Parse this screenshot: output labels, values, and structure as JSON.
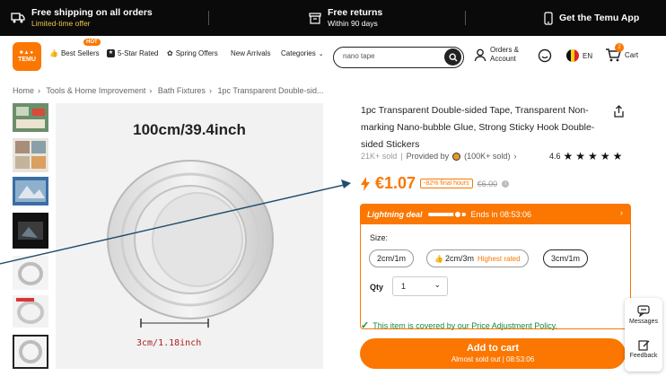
{
  "promo": {
    "shipping_title": "Free shipping on all orders",
    "shipping_sub": "Limited-time offer",
    "returns_title": "Free returns",
    "returns_sub": "Within 90 days",
    "app": "Get the Temu App"
  },
  "header": {
    "logo_line1": "TEMU",
    "nav": {
      "hot_badge": "HOT",
      "best_sellers": "Best Sellers",
      "five_star": "5-Star Rated",
      "spring": "Spring Offers",
      "new_arrivals": "New Arrivals",
      "categories": "Categories"
    },
    "search_value": "nano tape",
    "orders": "Orders &",
    "account": "Account",
    "lang": "EN",
    "cart": "Cart",
    "cart_count": "2"
  },
  "breadcrumb": [
    "Home",
    "Tools & Home Improvement",
    "Bath Fixtures",
    "1pc Transparent Double-sid..."
  ],
  "image": {
    "dimension_top": "100cm/39.4inch",
    "dimension_bottom": "3cm/1.18inch"
  },
  "product": {
    "title": "1pc Transparent Double-sided Tape, Transparent Non-marking Nano-bubble Glue, Strong Sticky Hook Double-sided Stickers",
    "sold": "21K+ sold",
    "provided_by": "Provided by",
    "seller_sold": "(100K+ sold)",
    "rating": "4.6",
    "rating_value": 4.6,
    "price": "€1.07",
    "discount": "-82% final hours",
    "original_price": "€6.00"
  },
  "deal": {
    "label": "Lightning deal",
    "ends": "Ends in 08:53:06",
    "size_label": "Size:",
    "sizes": [
      {
        "label": "2cm/1m",
        "tag": ""
      },
      {
        "label": "2cm/3m",
        "tag": "Highest rated"
      },
      {
        "label": "3cm/1m",
        "tag": ""
      }
    ],
    "qty_label": "Qty",
    "qty_value": "1"
  },
  "protect": "This item is covered by our Price Adjustment Policy.",
  "cart_button": {
    "label": "Add to cart",
    "sub": "Almost sold out | 08:53:06"
  },
  "side": {
    "messages": "Messages",
    "feedback": "Feedback"
  },
  "colors": {
    "accent": "#fb7701",
    "promo_bg": "#0a0a0a",
    "green": "#1a8a3c"
  }
}
